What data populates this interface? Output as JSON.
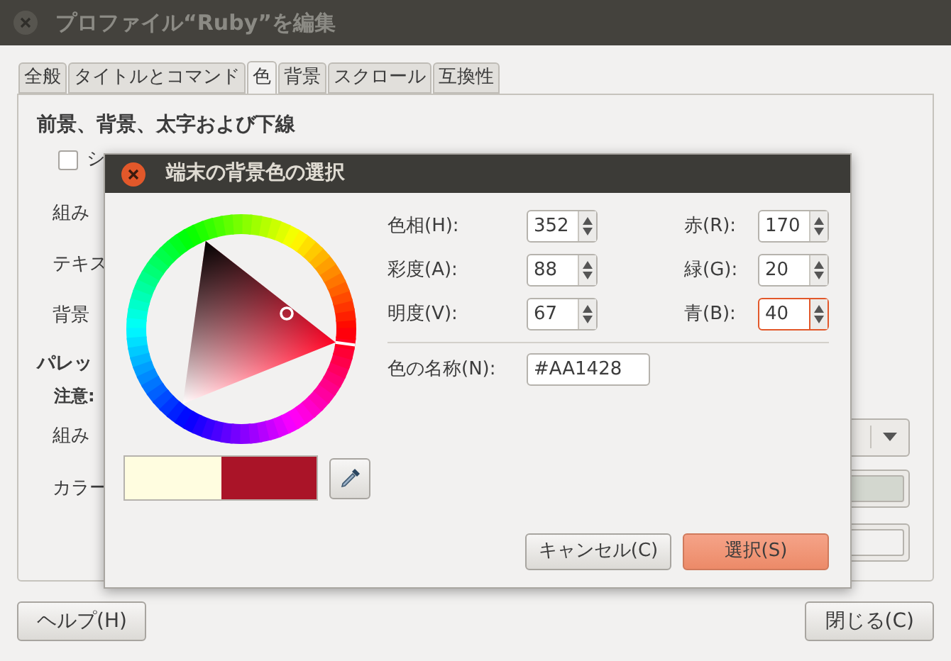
{
  "window": {
    "title": "プロファイル“Ruby”を編集"
  },
  "tabs": [
    {
      "label": "全般",
      "selected": false
    },
    {
      "label": "タイトルとコマンド",
      "selected": false
    },
    {
      "label": "色",
      "selected": true
    },
    {
      "label": "背景",
      "selected": false
    },
    {
      "label": "スクロール",
      "selected": false
    },
    {
      "label": "互換性",
      "selected": false
    }
  ],
  "section_heading": "前景、背景、太字および下線",
  "system_colors_checkbox": {
    "label": "シ",
    "checked": false
  },
  "rows": [
    {
      "kind": "label",
      "label": "組み"
    },
    {
      "kind": "label",
      "label": "テキス"
    },
    {
      "kind": "label",
      "label": "背景"
    },
    {
      "kind": "heading",
      "label": "パレッ"
    },
    {
      "kind": "note",
      "label": "注意:"
    },
    {
      "kind": "combo",
      "label": "組み"
    },
    {
      "kind": "color",
      "label": "カラー",
      "color": "#d3d7cf"
    },
    {
      "kind": "color",
      "color": "#f2f1f0"
    }
  ],
  "buttons": [
    {
      "label": "ヘルプ(H)"
    },
    {
      "label": "閉じる(C)"
    }
  ],
  "dialog": {
    "title": "端末の背景色の選択",
    "hsv_fields": [
      {
        "label": "色相(H):",
        "value": "352"
      },
      {
        "label": "彩度(A):",
        "value": "88"
      },
      {
        "label": "明度(V):",
        "value": "67"
      }
    ],
    "rgb_fields": [
      {
        "label": "赤(R):",
        "value": "170",
        "focused": false
      },
      {
        "label": "緑(G):",
        "value": "20",
        "focused": false
      },
      {
        "label": "青(B):",
        "value": "40",
        "focused": true
      }
    ],
    "color_name": {
      "label": "色の名称(N):",
      "value": "#AA1428"
    },
    "swatches": [
      {
        "color": "#fffde0"
      },
      {
        "color": "#aa1428"
      }
    ],
    "buttons": [
      {
        "label": "キャンセル(C)",
        "default": false
      },
      {
        "label": "選択(S)",
        "default": true
      }
    ]
  }
}
